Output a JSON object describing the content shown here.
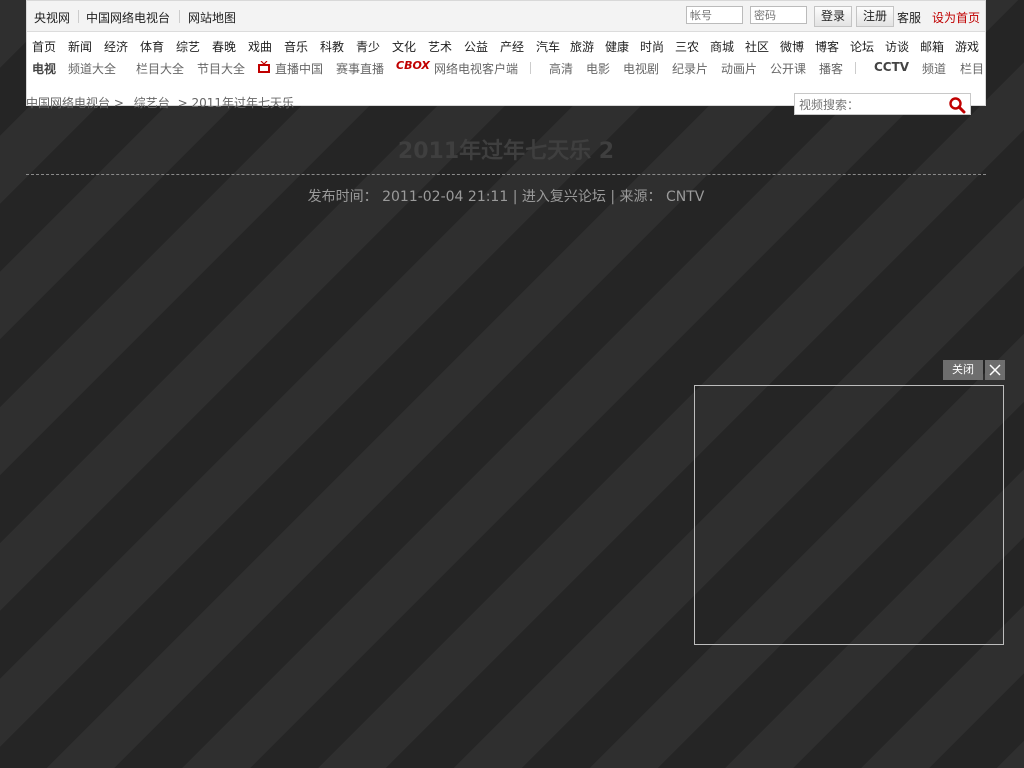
{
  "topbar": {
    "links": [
      "央视网",
      "中国网络电视台",
      "网站地图"
    ],
    "account_placeholder": "帐号",
    "password_placeholder": "密码",
    "login_label": "登录",
    "register_label": "注册",
    "service_label": "客服",
    "homepage_label": "设为首页"
  },
  "nav_primary": [
    "首页",
    "新闻",
    "经济",
    "体育",
    "综艺",
    "春晚",
    "戏曲",
    "音乐",
    "科教",
    "青少",
    "文化",
    "艺术",
    "公益",
    "产经",
    "汽车",
    "旅游",
    "健康",
    "时尚",
    "三农",
    "商城",
    "社区",
    "微博",
    "博客",
    "论坛",
    "访谈",
    "邮箱",
    "游戏"
  ],
  "nav_secondary": {
    "tv_label": "电视",
    "items": [
      "频道大全",
      "栏目大全",
      "节目大全",
      "直播中国",
      "赛事直播"
    ],
    "cbox_label": "CBOX",
    "client_label": "网络电视客户端",
    "video_items": [
      "高清",
      "电影",
      "电视剧",
      "纪录片",
      "动画片",
      "公开课",
      "播客"
    ],
    "cctv_label": "CCTV",
    "cctv_items": [
      "频道",
      "栏目"
    ]
  },
  "breadcrumb": {
    "home": "中国网络电视台",
    "section": "综艺台",
    "current": "2011年过年七天乐",
    "sep": ">"
  },
  "search": {
    "placeholder": "视频搜索："
  },
  "article": {
    "title": "2011年过年七天乐 2",
    "publish_label": "发布时间：",
    "publish_time": "2011-02-04 21:11",
    "forum_link": "进入复兴论坛",
    "source_label": "来源：",
    "source": "CNTV"
  },
  "floating_ad": {
    "close_label": "关闭"
  },
  "colors": {
    "accent": "#c00000",
    "background": "#2b2b2b"
  }
}
